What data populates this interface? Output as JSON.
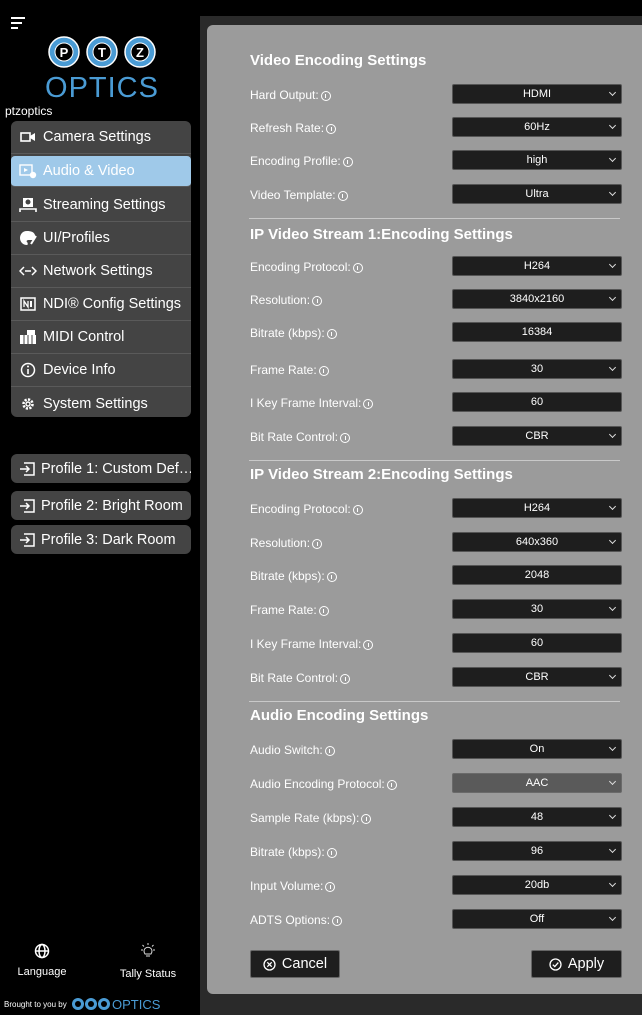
{
  "account": {
    "name": "ptzoptics"
  },
  "logo": {
    "letters": [
      "P",
      "T",
      "Z"
    ],
    "wordmark": "OPTICS"
  },
  "nav": {
    "items": [
      {
        "label": "Camera Settings",
        "icon": "camera-icon"
      },
      {
        "label": "Audio & Video",
        "icon": "audio-video-icon",
        "active": true
      },
      {
        "label": "Streaming Settings",
        "icon": "streaming-icon"
      },
      {
        "label": "UI/Profiles",
        "icon": "palette-icon"
      },
      {
        "label": "Network Settings",
        "icon": "network-icon"
      },
      {
        "label": "NDI® Config Settings",
        "icon": "ndi-icon"
      },
      {
        "label": "MIDI Control",
        "icon": "midi-icon"
      },
      {
        "label": "Device Info",
        "icon": "info-icon"
      },
      {
        "label": "System Settings",
        "icon": "gear-icon"
      }
    ]
  },
  "profiles": [
    {
      "label": "Profile 1: Custom Def…"
    },
    {
      "label": "Profile 2: Bright Room"
    },
    {
      "label": "Profile 3: Dark Room"
    }
  ],
  "footer": {
    "language_label": "Language",
    "tally_label": "Tally Status",
    "brought_by": "Brought to you by",
    "mini_wordmark": "OPTICS"
  },
  "sections": {
    "video_encoding": {
      "title": "Video Encoding Settings",
      "rows": [
        {
          "label": "Hard Output:",
          "value": "HDMI"
        },
        {
          "label": "Refresh Rate:",
          "value": "60Hz"
        },
        {
          "label": "Encoding Profile:",
          "value": "high"
        },
        {
          "label": "Video Template:",
          "value": "Ultra"
        }
      ]
    },
    "stream1": {
      "title": "IP Video Stream 1:Encoding Settings",
      "rows": [
        {
          "label": "Encoding Protocol:",
          "value": "H264"
        },
        {
          "label": "Resolution:",
          "value": "3840x2160"
        },
        {
          "label": "Bitrate (kbps):",
          "value": "16384"
        },
        {
          "label": "Frame Rate:",
          "value": "30"
        },
        {
          "label": "I Key Frame Interval:",
          "value": "60"
        },
        {
          "label": "Bit Rate Control:",
          "value": "CBR"
        }
      ]
    },
    "stream2": {
      "title": "IP Video Stream 2:Encoding Settings",
      "rows": [
        {
          "label": "Encoding Protocol:",
          "value": "H264"
        },
        {
          "label": "Resolution:",
          "value": "640x360"
        },
        {
          "label": "Bitrate (kbps):",
          "value": "2048"
        },
        {
          "label": "Frame Rate:",
          "value": "30"
        },
        {
          "label": "I Key Frame Interval:",
          "value": "60"
        },
        {
          "label": "Bit Rate Control:",
          "value": "CBR"
        }
      ]
    },
    "audio": {
      "title": "Audio Encoding Settings",
      "rows": [
        {
          "label": "Audio Switch:",
          "value": "On"
        },
        {
          "label": "Audio Encoding Protocol:",
          "value": "AAC"
        },
        {
          "label": "Sample Rate (kbps):",
          "value": "48"
        },
        {
          "label": "Bitrate (kbps):",
          "value": "96"
        },
        {
          "label": "Input Volume:",
          "value": "20db"
        },
        {
          "label": "ADTS Options:",
          "value": "Off"
        }
      ]
    }
  },
  "actions": {
    "cancel_label": "Cancel",
    "apply_label": "Apply"
  },
  "colors": {
    "active_nav": "#9fc9e9",
    "logo_blue": "#4a9bd4",
    "panel": "#9b9b9b"
  }
}
